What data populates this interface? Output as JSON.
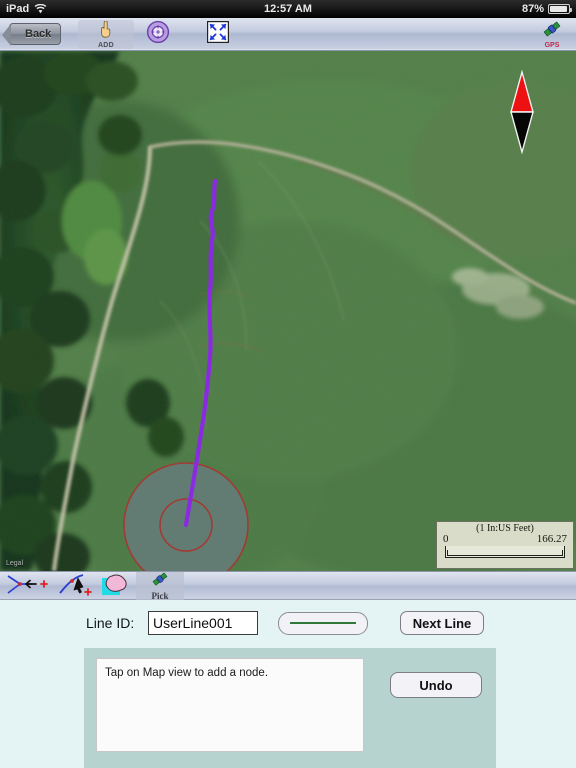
{
  "status_bar": {
    "carrier": "iPad",
    "wifi_icon": "wifi-icon",
    "time": "12:57 AM",
    "battery_percent": "87%",
    "battery_icon": "battery-icon"
  },
  "toolbar": {
    "back_label": "Back",
    "add_label": "ADD",
    "add_icon": "pointing-hand-icon",
    "target_icon": "crosshair-circle-icon",
    "fullscreen_icon": "expand-arrows-icon",
    "gps_label": "GPS",
    "gps_icon": "satellite-icon"
  },
  "map": {
    "attribution": "Legal",
    "north_arrow_icon": "north-arrow-icon",
    "scale": {
      "title": "(1 In:US Feet)",
      "min": "0",
      "max": "166.27"
    },
    "feature_colors": {
      "line": "#8a2be2",
      "buffer_outline": "#a03030",
      "buffer_fill": "#7d8a99"
    }
  },
  "tabs": [
    {
      "name": "add-node-tab",
      "icon": "node-insert-icon",
      "label": ""
    },
    {
      "name": "move-node-tab",
      "icon": "node-move-icon",
      "label": ""
    },
    {
      "name": "polygon-tab",
      "icon": "polygon-select-icon",
      "label": ""
    },
    {
      "name": "pick-tab",
      "icon": "satellite-icon",
      "label": "Pick"
    }
  ],
  "form": {
    "line_id_label": "Line ID:",
    "line_id_value": "UserLine001",
    "line_id_placeholder": "Line ID",
    "style_swatch_name": "line-style-swatch",
    "style_swatch_color": "#2f7a39",
    "next_line_label": "Next Line",
    "message": "Tap on Map view to add a node.",
    "undo_label": "Undo"
  }
}
